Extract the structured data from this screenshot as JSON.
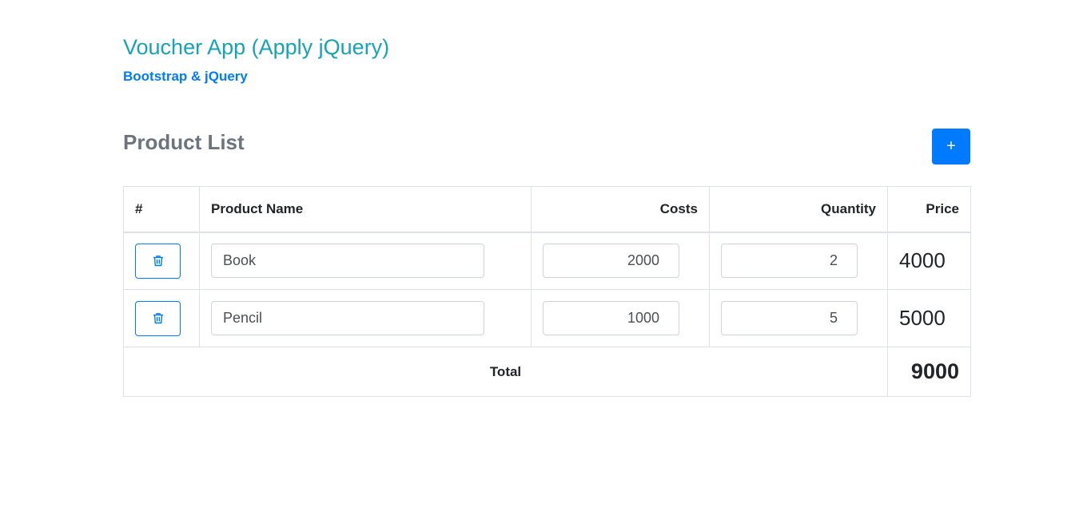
{
  "header": {
    "title": "Voucher App (Apply jQuery)",
    "subtitle": "Bootstrap & jQuery"
  },
  "section": {
    "title": "Product List",
    "add_label": "+"
  },
  "table": {
    "columns": [
      "#",
      "Product Name",
      "Costs",
      "Quantity",
      "Price"
    ],
    "rows": [
      {
        "name": "Book",
        "costs": "2000",
        "quantity": "2",
        "price": "4000"
      },
      {
        "name": "Pencil",
        "costs": "1000",
        "quantity": "5",
        "price": "5000"
      }
    ],
    "total_label": "Total",
    "total_value": "9000"
  },
  "colors": {
    "title": "#17a2b8",
    "subtitle": "#007bff",
    "primary": "#007bff",
    "muted": "#6c757d"
  },
  "icons": {
    "delete": "trash-icon"
  }
}
